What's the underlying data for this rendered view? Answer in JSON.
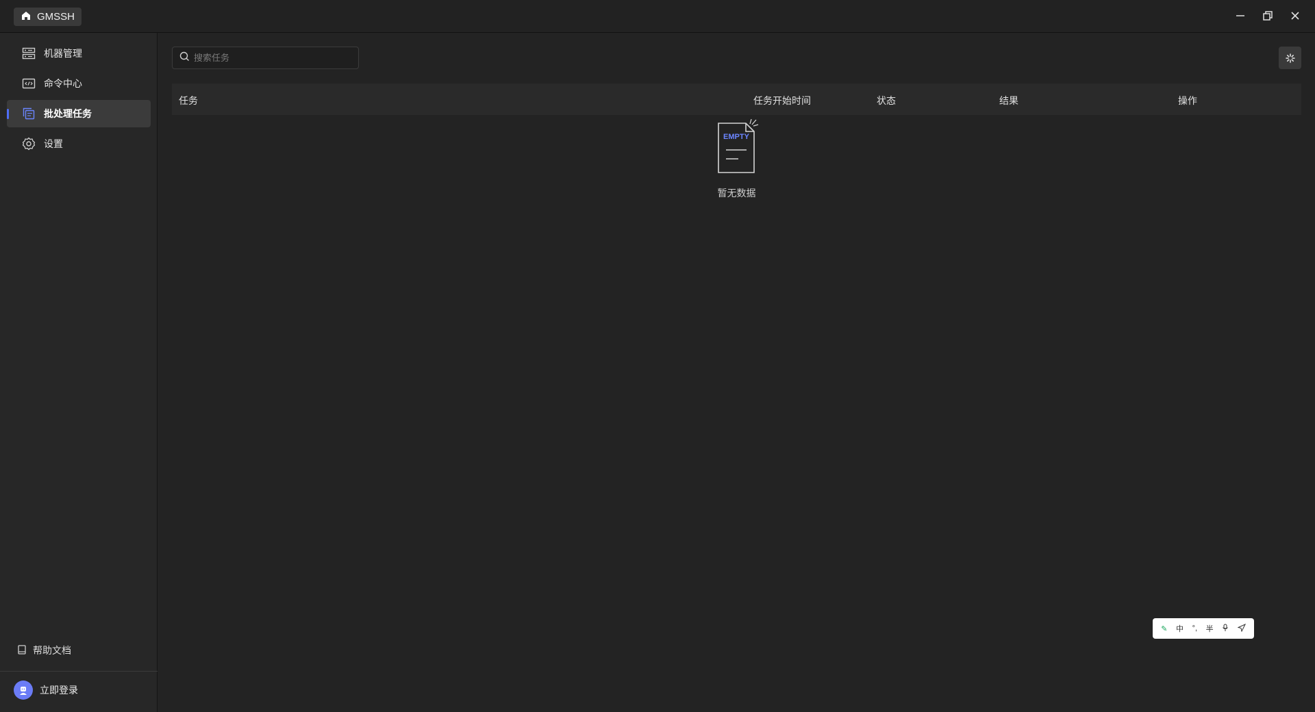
{
  "app": {
    "title": "GMSSH"
  },
  "sidebar": {
    "items": [
      {
        "label": "机器管理",
        "icon": "server-icon"
      },
      {
        "label": "命令中心",
        "icon": "terminal-icon"
      },
      {
        "label": "批处理任务",
        "icon": "batch-icon",
        "active": true
      },
      {
        "label": "设置",
        "icon": "gear-icon"
      }
    ],
    "help_label": "帮助文档",
    "login_label": "立即登录"
  },
  "search": {
    "placeholder": "搜索任务",
    "value": ""
  },
  "table": {
    "columns": [
      "任务",
      "任务开始时间",
      "状态",
      "结果",
      "操作"
    ],
    "rows": []
  },
  "empty": {
    "badge": "EMPTY",
    "text": "暂无数据"
  },
  "ime_toolbar": {
    "items": [
      "中",
      "°,",
      "半"
    ]
  },
  "colors": {
    "accent": "#4f6ef7",
    "background": "#232323",
    "sidebar": "#272727"
  }
}
